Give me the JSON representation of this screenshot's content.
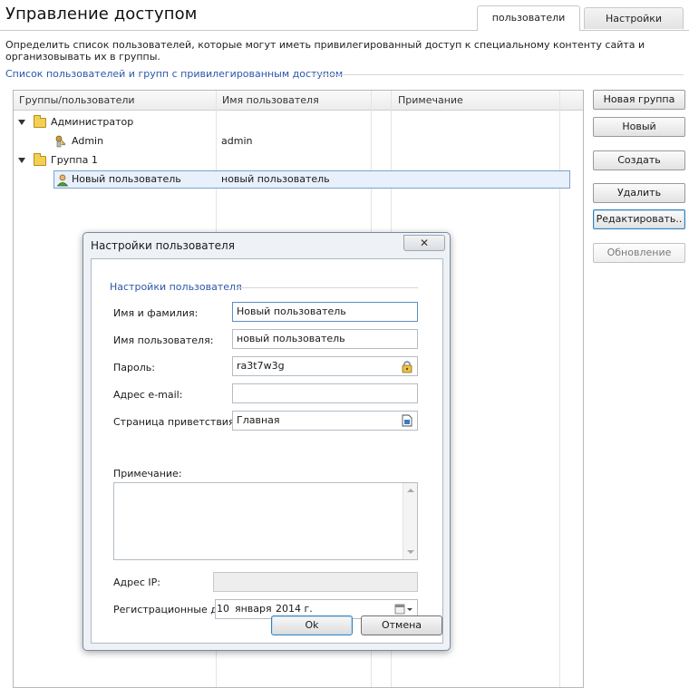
{
  "page": {
    "title": "Управление доступом",
    "description": "Определить список пользователей, которые могут иметь привилегированный доступ к специальному контенту сайта и организовывать их в группы.",
    "section_title": "Список пользователей и групп с привилегированным доступом"
  },
  "tabs": [
    {
      "label": "пользователи",
      "active": true
    },
    {
      "label": "Настройки",
      "active": false
    }
  ],
  "tree": {
    "columns": [
      "Группы/пользователи",
      "Имя пользователя",
      "Примечание"
    ],
    "rows": [
      {
        "type": "group",
        "name": "Администратор",
        "username": "",
        "note": ""
      },
      {
        "type": "user",
        "name": "Admin",
        "username": "admin",
        "note": ""
      },
      {
        "type": "group",
        "name": "Группа 1",
        "username": "",
        "note": ""
      },
      {
        "type": "user",
        "name": "Новый пользователь",
        "username": "новый пользователь",
        "note": "",
        "selected": true
      }
    ]
  },
  "side_buttons": {
    "new_group": "Новая группа",
    "new": "Новый",
    "create": "Создать",
    "delete": "Удалить",
    "edit": "Редактировать..",
    "refresh": "Обновление"
  },
  "dialog": {
    "title": "Настройки пользователя",
    "group_title": "Настройки пользователя",
    "labels": {
      "full_name": "Имя и фамилия:",
      "username": "Имя пользователя:",
      "password": "Пароль:",
      "email": "Адрес e-mail:",
      "welcome_page": "Страница приветствия:",
      "note": "Примечание:",
      "ip": "Адрес IP:",
      "reg_date": "Регистрационные данные"
    },
    "values": {
      "full_name": "Новый пользователь",
      "username": "новый пользователь",
      "password": "ra3t7w3g",
      "email": "",
      "welcome_page": "Главная",
      "note": "",
      "ip": "",
      "reg_day": "10",
      "reg_month": "января",
      "reg_year": "2014 г."
    },
    "ok_label": "Ok",
    "cancel_label": "Отмена",
    "close_glyph": "✕"
  },
  "colors": {
    "accent_blue": "#2a56a8",
    "selection_bg": "#e7f0fb",
    "selection_border": "#7da2ce",
    "folder": "#f3cf55"
  },
  "icons": {
    "group": "folder-icon",
    "admin": "admin-user-icon",
    "user": "user-icon",
    "password_generator": "key-lock-icon",
    "page_picker": "page-icon",
    "calendar": "calendar-icon"
  }
}
